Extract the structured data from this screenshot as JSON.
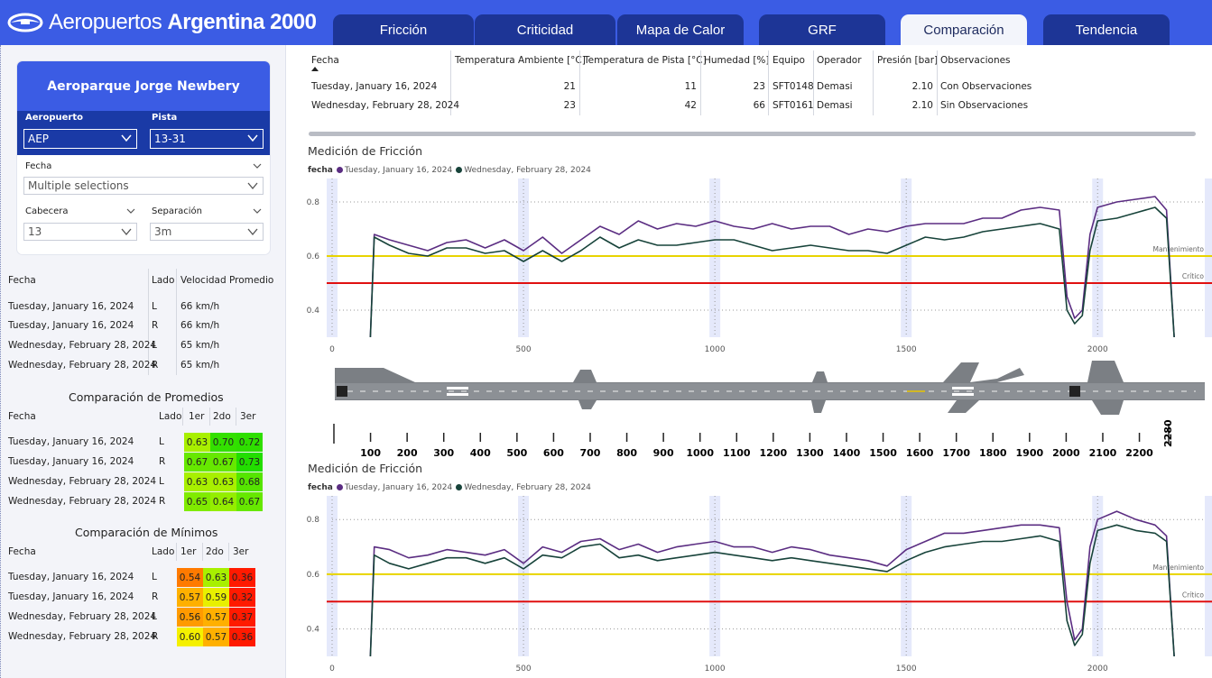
{
  "app": {
    "logo_light": "Aeropuertos",
    "logo_bold": "Argentina 2000"
  },
  "tabs": [
    {
      "label": "Fricción"
    },
    {
      "label": "Criticidad"
    },
    {
      "label": "Mapa de Calor"
    },
    {
      "label": "GRF"
    },
    {
      "label": "Comparación",
      "active": true
    },
    {
      "label": "Tendencia"
    }
  ],
  "filters": {
    "airport_name": "Aeroparque Jorge Newbery",
    "aeropuerto_label": "Aeropuerto",
    "aeropuerto_value": "AEP",
    "pista_label": "Pista",
    "pista_value": "13-31",
    "fecha_label": "Fecha",
    "fecha_value": "Multiple selections",
    "cabecera_label": "Cabecera",
    "cabecera_value": "13",
    "separacion_label": "Separación",
    "separacion_value": "3m"
  },
  "speed_table": {
    "headers": [
      "Fecha",
      "Lado",
      "Velocidad Promedio"
    ],
    "rows": [
      [
        "Tuesday, January 16, 2024",
        "L",
        "66 km/h"
      ],
      [
        "Tuesday, January 16, 2024",
        "R",
        "66 km/h"
      ],
      [
        "Wednesday, February 28, 2024",
        "L",
        "65 km/h"
      ],
      [
        "Wednesday, February 28, 2024",
        "R",
        "65 km/h"
      ]
    ]
  },
  "promedios": {
    "title": "Comparación de Promedios",
    "headers": [
      "Fecha",
      "Lado",
      "1er",
      "2do",
      "3er"
    ],
    "rows": [
      {
        "fecha": "Tuesday, January 16, 2024",
        "lado": "L",
        "vals": [
          "0.63",
          "0.70",
          "0.72"
        ],
        "colors": [
          "#a8f000",
          "#33e000",
          "#2edf00"
        ]
      },
      {
        "fecha": "Tuesday, January 16, 2024",
        "lado": "R",
        "vals": [
          "0.67",
          "0.67",
          "0.73"
        ],
        "colors": [
          "#66e800",
          "#66e800",
          "#22de00"
        ]
      },
      {
        "fecha": "Wednesday, February 28, 2024",
        "lado": "L",
        "vals": [
          "0.63",
          "0.63",
          "0.68"
        ],
        "colors": [
          "#a8f000",
          "#a8f000",
          "#55e500"
        ]
      },
      {
        "fecha": "Wednesday, February 28, 2024",
        "lado": "R",
        "vals": [
          "0.65",
          "0.64",
          "0.67"
        ],
        "colors": [
          "#80eb00",
          "#94ee00",
          "#66e800"
        ]
      }
    ]
  },
  "minimos": {
    "title": "Comparación de Mínimos",
    "headers": [
      "Fecha",
      "Lado",
      "1er",
      "2do",
      "3er"
    ],
    "rows": [
      {
        "fecha": "Tuesday, January 16, 2024",
        "lado": "L",
        "vals": [
          "0.54",
          "0.63",
          "0.36"
        ],
        "colors": [
          "#ff7a00",
          "#a8f000",
          "#ff1a00"
        ]
      },
      {
        "fecha": "Tuesday, January 16, 2024",
        "lado": "R",
        "vals": [
          "0.57",
          "0.59",
          "0.32"
        ],
        "colors": [
          "#ffb000",
          "#e8f000",
          "#ff1a00"
        ]
      },
      {
        "fecha": "Wednesday, February 28, 2024",
        "lado": "L",
        "vals": [
          "0.56",
          "0.57",
          "0.37"
        ],
        "colors": [
          "#ff9a00",
          "#ffb000",
          "#ff1a00"
        ]
      },
      {
        "fecha": "Wednesday, February 28, 2024",
        "lado": "R",
        "vals": [
          "0.60",
          "0.57",
          "0.36"
        ],
        "colors": [
          "#f5f000",
          "#ffb000",
          "#ff1a00"
        ]
      }
    ]
  },
  "conditions": {
    "headers": [
      "Fecha",
      "Temperatura Ambiente [°C]",
      "Temperatura de Pista [°C]",
      "Humedad [%]",
      "Equipo",
      "Operador",
      "Presión [bar]",
      "Observaciones"
    ],
    "rows": [
      [
        "Tuesday, January 16, 2024",
        "21",
        "11",
        "23",
        "SFT0148",
        "Demasi",
        "2.10",
        "Con Observaciones"
      ],
      [
        "Wednesday, February 28, 2024",
        "23",
        "42",
        "66",
        "SFT0161",
        "Demasi",
        "2.10",
        "Sin Observaciones"
      ]
    ]
  },
  "charts": {
    "title": "Medición de Fricción",
    "legend_label": "fecha",
    "ruler_ticks": [
      "100",
      "200",
      "300",
      "400",
      "500",
      "600",
      "700",
      "800",
      "900",
      "1000",
      "1100",
      "1200",
      "1300",
      "1400",
      "1500",
      "1600",
      "1700",
      "1800",
      "1900",
      "2000",
      "2100",
      "2200"
    ],
    "ruler_end": "2280"
  },
  "chart_data": [
    {
      "type": "line",
      "title": "Medición de Fricción",
      "legend_title": "fecha",
      "x": [
        0,
        100,
        110,
        150,
        200,
        250,
        300,
        350,
        400,
        450,
        500,
        550,
        600,
        650,
        700,
        750,
        800,
        850,
        900,
        950,
        1000,
        1050,
        1100,
        1150,
        1200,
        1250,
        1300,
        1350,
        1400,
        1450,
        1500,
        1550,
        1600,
        1650,
        1700,
        1750,
        1800,
        1850,
        1900,
        1920,
        1940,
        1960,
        1980,
        2000,
        2050,
        2100,
        2150,
        2180,
        2200
      ],
      "series": [
        {
          "name": "Tuesday, January 16, 2024",
          "color": "#5b2d82",
          "values": [
            null,
            0.3,
            0.68,
            0.66,
            0.64,
            0.62,
            0.65,
            0.66,
            0.63,
            0.66,
            0.62,
            0.67,
            0.61,
            0.66,
            0.71,
            0.68,
            0.73,
            0.7,
            0.72,
            0.71,
            0.73,
            0.71,
            0.7,
            0.72,
            0.7,
            0.71,
            0.71,
            0.68,
            0.7,
            0.69,
            0.71,
            0.72,
            0.72,
            0.72,
            0.74,
            0.74,
            0.77,
            0.78,
            0.77,
            0.45,
            0.37,
            0.4,
            0.68,
            0.78,
            0.8,
            0.81,
            0.82,
            0.77,
            0.3
          ]
        },
        {
          "name": "Wednesday, February 28, 2024",
          "color": "#17433a",
          "values": [
            null,
            0.3,
            0.67,
            0.64,
            0.61,
            0.6,
            0.63,
            0.63,
            0.61,
            0.62,
            0.58,
            0.62,
            0.58,
            0.62,
            0.67,
            0.63,
            0.66,
            0.64,
            0.64,
            0.65,
            0.66,
            0.66,
            0.64,
            0.62,
            0.63,
            0.64,
            0.63,
            0.62,
            0.62,
            0.61,
            0.64,
            0.67,
            0.66,
            0.67,
            0.69,
            0.7,
            0.71,
            0.72,
            0.7,
            0.4,
            0.35,
            0.38,
            0.62,
            0.73,
            0.74,
            0.76,
            0.78,
            0.74,
            0.3
          ]
        }
      ],
      "reference_lines": [
        {
          "label": "Mantenimiento",
          "value": 0.6,
          "color": "#e8d400"
        },
        {
          "label": "Crítico",
          "value": 0.5,
          "color": "#e01010"
        }
      ],
      "x_ticks": [
        0,
        500,
        1000,
        1500,
        2000
      ],
      "y_ticks": [
        0.4,
        0.6,
        0.8
      ],
      "xlim": [
        0,
        2280
      ],
      "ylim": [
        0.3,
        0.86
      ]
    },
    {
      "type": "line",
      "title": "Medición de Fricción",
      "legend_title": "fecha",
      "x": [
        0,
        100,
        110,
        150,
        200,
        250,
        300,
        350,
        400,
        450,
        500,
        550,
        600,
        650,
        700,
        750,
        800,
        850,
        900,
        950,
        1000,
        1050,
        1100,
        1150,
        1200,
        1250,
        1300,
        1350,
        1400,
        1450,
        1500,
        1550,
        1600,
        1650,
        1700,
        1750,
        1800,
        1850,
        1900,
        1920,
        1940,
        1960,
        1980,
        2000,
        2050,
        2100,
        2150,
        2180,
        2200
      ],
      "series": [
        {
          "name": "Tuesday, January 16, 2024",
          "color": "#5b2d82",
          "values": [
            null,
            0.3,
            0.7,
            0.69,
            0.66,
            0.67,
            0.69,
            0.68,
            0.67,
            0.69,
            0.64,
            0.7,
            0.68,
            0.72,
            0.73,
            0.69,
            0.71,
            0.68,
            0.7,
            0.71,
            0.72,
            0.7,
            0.7,
            0.68,
            0.7,
            0.69,
            0.67,
            0.66,
            0.65,
            0.63,
            0.69,
            0.72,
            0.75,
            0.75,
            0.76,
            0.77,
            0.78,
            0.78,
            0.77,
            0.5,
            0.36,
            0.4,
            0.7,
            0.8,
            0.83,
            0.8,
            0.78,
            0.74,
            0.3
          ]
        },
        {
          "name": "Wednesday, February 28, 2024",
          "color": "#17433a",
          "values": [
            null,
            0.3,
            0.67,
            0.64,
            0.62,
            0.64,
            0.66,
            0.66,
            0.64,
            0.66,
            0.62,
            0.67,
            0.66,
            0.7,
            0.71,
            0.66,
            0.67,
            0.65,
            0.66,
            0.67,
            0.68,
            0.67,
            0.66,
            0.65,
            0.66,
            0.65,
            0.64,
            0.63,
            0.62,
            0.61,
            0.65,
            0.68,
            0.7,
            0.71,
            0.72,
            0.72,
            0.73,
            0.74,
            0.72,
            0.43,
            0.34,
            0.38,
            0.64,
            0.76,
            0.78,
            0.76,
            0.75,
            0.72,
            0.3
          ]
        }
      ],
      "reference_lines": [
        {
          "label": "Mantenimiento",
          "value": 0.6,
          "color": "#e8d400"
        },
        {
          "label": "Crítico",
          "value": 0.5,
          "color": "#e01010"
        }
      ],
      "x_ticks": [
        0,
        500,
        1000,
        1500,
        2000
      ],
      "y_ticks": [
        0.4,
        0.6,
        0.8
      ],
      "xlim": [
        0,
        2280
      ],
      "ylim": [
        0.3,
        0.86
      ]
    }
  ]
}
